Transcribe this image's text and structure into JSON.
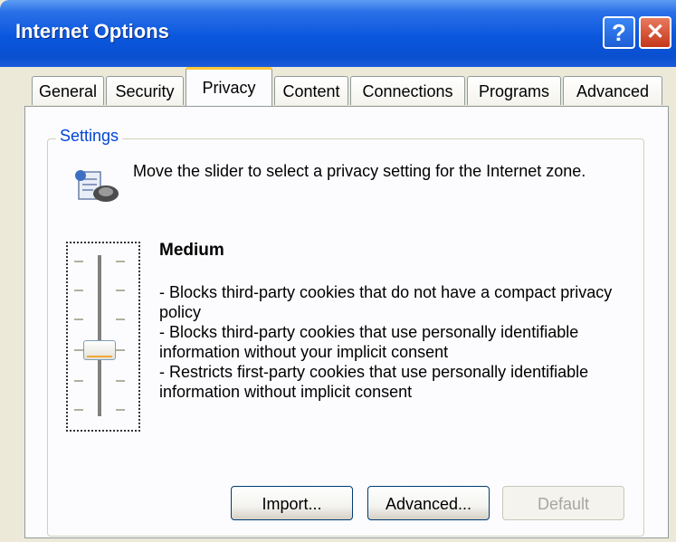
{
  "window": {
    "title": "Internet Options"
  },
  "titlebar": {
    "help": "?",
    "close": "✕"
  },
  "tabs": [
    {
      "label": "General"
    },
    {
      "label": "Security"
    },
    {
      "label": "Privacy",
      "active": true
    },
    {
      "label": "Content"
    },
    {
      "label": "Connections"
    },
    {
      "label": "Programs"
    },
    {
      "label": "Advanced"
    }
  ],
  "settings": {
    "group_label": "Settings",
    "intro": "Move the slider to select a privacy setting for the Internet zone.",
    "level": "Medium",
    "details": [
      "- Blocks third-party cookies that do not have a compact privacy policy",
      "- Blocks third-party cookies that use personally identifiable information without your implicit consent",
      "- Restricts first-party cookies that use personally identifiable information without implicit consent"
    ]
  },
  "buttons": {
    "import": "Import...",
    "advanced": "Advanced...",
    "default": "Default"
  }
}
